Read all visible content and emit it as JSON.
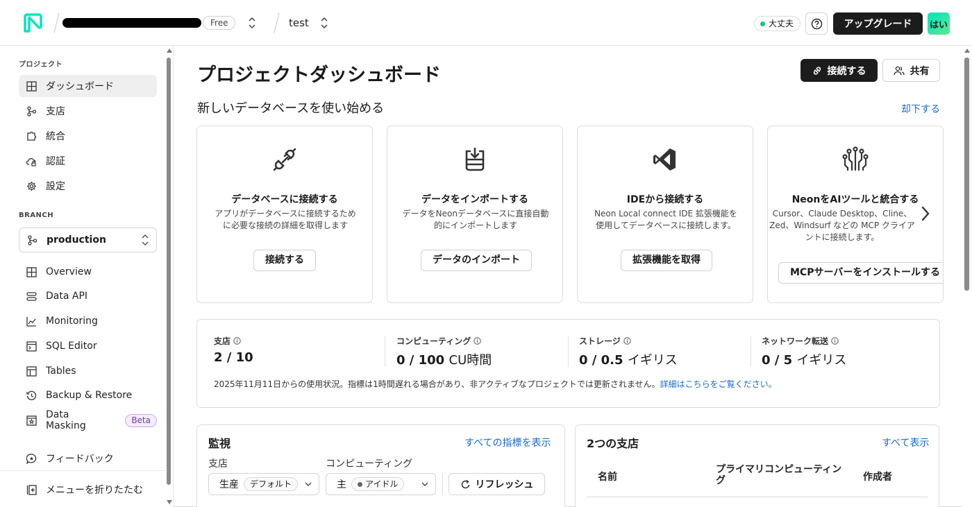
{
  "topbar": {
    "plan_badge": "Free",
    "project_name": "test",
    "status": "大丈夫",
    "help_icon": "question-circle-icon",
    "upgrade_label": "アップグレード",
    "avatar_label": "はい",
    "colors": {
      "logo": "#00e5bf",
      "status": "#1ec27a"
    }
  },
  "sidebar": {
    "project_heading": "プロジェクト",
    "project_items": [
      {
        "label": "ダッシュボード",
        "icon": "grid-icon",
        "active": true
      },
      {
        "label": "支店",
        "icon": "branch-icon"
      },
      {
        "label": "統合",
        "icon": "puzzle-icon"
      },
      {
        "label": "認証",
        "icon": "cloud-lock-icon"
      },
      {
        "label": "設定",
        "icon": "gear-icon"
      }
    ],
    "branch_heading": "BRANCH",
    "branch_selected": "production",
    "branch_items": [
      {
        "label": "Overview",
        "icon": "grid-icon"
      },
      {
        "label": "Data API",
        "icon": "data-api-icon"
      },
      {
        "label": "Monitoring",
        "icon": "chart-line-icon"
      },
      {
        "label": "SQL Editor",
        "icon": "terminal-icon"
      },
      {
        "label": "Tables",
        "icon": "table-icon"
      },
      {
        "label": "Backup & Restore",
        "icon": "history-icon"
      },
      {
        "label": "Data Masking",
        "icon": "star-box-icon",
        "badge": "Beta"
      }
    ],
    "feedback_label": "フィードバック",
    "collapse_label": "メニューを折りたたむ"
  },
  "main": {
    "title": "プロジェクトダッシュボード",
    "connect_label": "接続する",
    "share_label": "共有",
    "getting_started_title": "新しいデータベースを使い始める",
    "dismiss_label": "却下する",
    "cards": [
      {
        "icon": "plug-icon",
        "title": "データベースに接続する",
        "desc": "アプリがデータベースに接続するために必要な接続の詳細を取得します",
        "button": "接続する"
      },
      {
        "icon": "database-import-icon",
        "title": "データをインポートする",
        "desc": "データをNeonデータベースに直接自動的にインポートします",
        "button": "データのインポート"
      },
      {
        "icon": "vscode-icon",
        "title": "IDEから接続する",
        "desc": "Neon Local connect IDE 拡張機能を使用してデータベースに接続します。",
        "button": "拡張機能を取得"
      },
      {
        "icon": "circuit-icon",
        "title": "NeonをAIツールと統合する",
        "desc": "Cursor、Claude Desktop、Cline、Zed、Windsurf などの MCP クライアントに接続します。",
        "button": "MCPサーバーをインストールする"
      }
    ],
    "usage": {
      "metrics": [
        {
          "label": "支店",
          "value": "2 / 10",
          "unit": ""
        },
        {
          "label": "コンピューティング",
          "value": "0 / 100",
          "unit": "CU時間"
        },
        {
          "label": "ストレージ",
          "value": "0 / 0.5",
          "unit": "イギリス"
        },
        {
          "label": "ネットワーク転送",
          "value": "0 / 5",
          "unit": "イギリス"
        }
      ],
      "note": "2025年11月11日からの使用状況。指標は1時間遅れる場合があり、非アクティブなプロジェクトでは更新されません。",
      "note_link": "詳細はこちらをご覧ください。"
    },
    "monitoring": {
      "title": "監視",
      "link": "すべての指標を表示",
      "branch_label": "支店",
      "branch_value": "生産",
      "branch_chip": "デフォルト",
      "compute_label": "コンピューティング",
      "compute_value": "主",
      "compute_chip": "アイドル",
      "refresh_label": "リフレッシュ"
    },
    "branches": {
      "title": "2つの支店",
      "link": "すべて表示",
      "columns": [
        "名前",
        "プライマリコンピューティング",
        "作成者"
      ]
    }
  }
}
